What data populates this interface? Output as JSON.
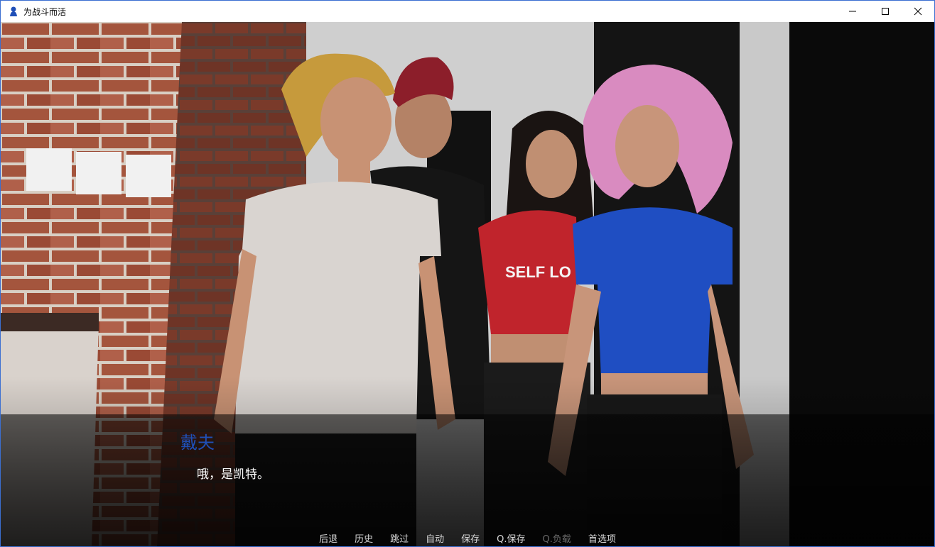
{
  "window": {
    "title": "为战斗而活",
    "icon": "game-app-icon",
    "controls": [
      "minimize-icon",
      "maximize-icon",
      "close-icon"
    ]
  },
  "dialogue": {
    "speaker": "戴夫",
    "speaker_color": "#1f4fb7",
    "text": "哦，是凯特。"
  },
  "scene": {
    "shirt_text": "SELF LO"
  },
  "quick_menu": {
    "back": "后退",
    "history": "历史",
    "skip": "跳过",
    "auto": "自动",
    "save": "保存",
    "quick_save": "Q.保存",
    "quick_load": "Q.负载",
    "preferences": "首选项"
  }
}
